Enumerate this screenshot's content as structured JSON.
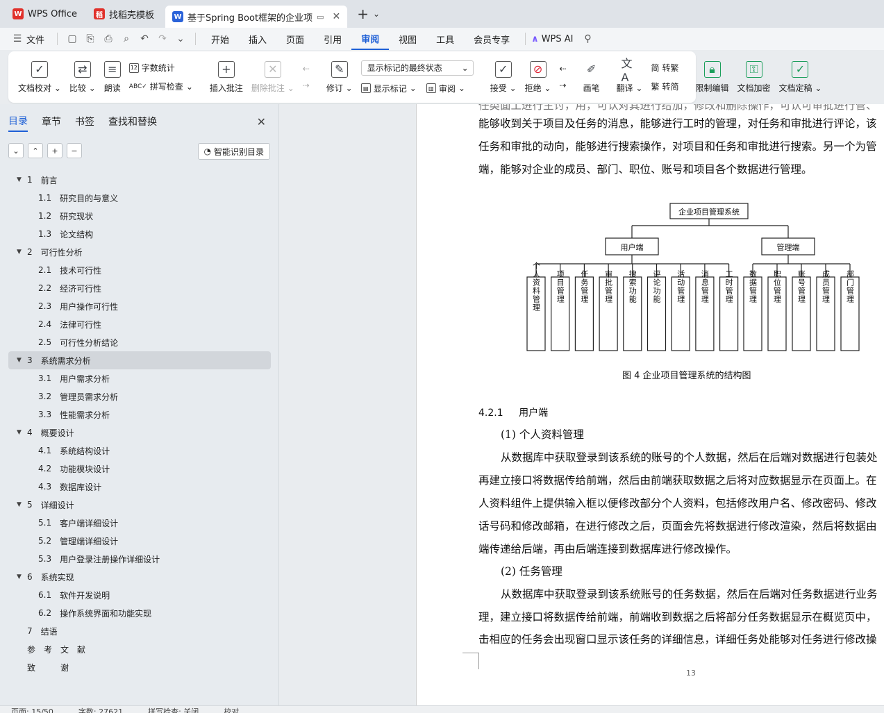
{
  "tabs": [
    {
      "label": "WPS Office",
      "icon": "wps-logo-icon",
      "color": "#e0312b"
    },
    {
      "label": "找稻壳模板",
      "icon": "docer-logo-icon",
      "color": "#e0312b"
    },
    {
      "label": "基于Spring Boot框架的企业项",
      "icon": "word-doc-icon",
      "color": "#2b63d9",
      "active": true
    }
  ],
  "menu": {
    "file": "文件",
    "items": [
      "开始",
      "插入",
      "页面",
      "引用",
      "审阅",
      "视图",
      "工具",
      "会员专享"
    ],
    "active": "审阅",
    "ai": "WPS AI"
  },
  "ribbon": {
    "doc_check": "文档校对",
    "compare": "比较",
    "read_aloud": "朗读",
    "word_count": "字数统计",
    "spell_check": "拼写检查",
    "insert_comment": "插入批注",
    "delete_comment": "删除批注",
    "revise": "修订",
    "markup_state": "显示标记的最终状态",
    "show_markup": "显示标记",
    "review": "审阅",
    "accept": "接受",
    "reject": "拒绝",
    "pen": "画笔",
    "translate": "翻译",
    "to_traditional": "转繁",
    "to_simplified": "转简",
    "restrict_edit": "限制编辑",
    "doc_encrypt": "文档加密",
    "doc_finalize": "文档定稿"
  },
  "sidebar": {
    "tabs": [
      "目录",
      "章节",
      "书签",
      "查找和替换"
    ],
    "active_tab": "目录",
    "smart_toc": "智能识别目录",
    "toc": [
      {
        "level": 1,
        "num": "1",
        "title": "前言",
        "expanded": true
      },
      {
        "level": 2,
        "num": "1.1",
        "title": "研究目的与意义"
      },
      {
        "level": 2,
        "num": "1.2",
        "title": "研究现状"
      },
      {
        "level": 2,
        "num": "1.3",
        "title": "论文结构"
      },
      {
        "level": 1,
        "num": "2",
        "title": "可行性分析",
        "expanded": true
      },
      {
        "level": 2,
        "num": "2.1",
        "title": "技术可行性"
      },
      {
        "level": 2,
        "num": "2.2",
        "title": "经济可行性"
      },
      {
        "level": 2,
        "num": "2.3",
        "title": "用户操作可行性"
      },
      {
        "level": 2,
        "num": "2.4",
        "title": "法律可行性"
      },
      {
        "level": 2,
        "num": "2.5",
        "title": "可行性分析结论"
      },
      {
        "level": 1,
        "num": "3",
        "title": "系统需求分析",
        "expanded": true,
        "selected": true
      },
      {
        "level": 2,
        "num": "3.1",
        "title": "用户需求分析"
      },
      {
        "level": 2,
        "num": "3.2",
        "title": "管理员需求分析"
      },
      {
        "level": 2,
        "num": "3.3",
        "title": "性能需求分析"
      },
      {
        "level": 1,
        "num": "4",
        "title": "概要设计",
        "expanded": true
      },
      {
        "level": 2,
        "num": "4.1",
        "title": "系统结构设计"
      },
      {
        "level": 2,
        "num": "4.2",
        "title": "功能模块设计"
      },
      {
        "level": 2,
        "num": "4.3",
        "title": "数据库设计"
      },
      {
        "level": 1,
        "num": "5",
        "title": "详细设计",
        "expanded": true
      },
      {
        "level": 2,
        "num": "5.1",
        "title": "客户端详细设计"
      },
      {
        "level": 2,
        "num": "5.2",
        "title": "管理端详细设计"
      },
      {
        "level": 2,
        "num": "5.3",
        "title": "用户登录注册操作详细设计"
      },
      {
        "level": 1,
        "num": "6",
        "title": "系统实现",
        "expanded": true
      },
      {
        "level": 2,
        "num": "6.1",
        "title": "软件开发说明"
      },
      {
        "level": 2,
        "num": "6.2",
        "title": "操作系统界面和功能实现"
      },
      {
        "level": 1,
        "num": "7",
        "title": "结语",
        "noarrow": true
      },
      {
        "level": 1,
        "num": "",
        "title": "参　考　文　献",
        "noarrow": true
      },
      {
        "level": 1,
        "num": "",
        "title": "致　　　谢",
        "noarrow": true
      }
    ]
  },
  "document": {
    "top_lines": [
      "任类面工进行主讨，用，可认对其进行给加，修改和删除操作，可认可审批进行管、",
      "能够收到关于项目及任务的消息，能够进行工时的管理，对任务和审批进行评论，该",
      "任务和审批的动向，能够进行搜索操作，对项目和任务和审批进行搜索。另一个为管",
      "端，能够对企业的成员、部门、职位、账号和项目各个数据进行管理。"
    ],
    "diagram": {
      "root": "企业项目管理系统",
      "branches": [
        "用户端",
        "管理端"
      ],
      "user_leaves": [
        "个人资料管理",
        "项目管理",
        "任务管理",
        "审批管理",
        "搜索功能",
        "评论功能",
        "活动管理",
        "消息管理",
        "工时管理"
      ],
      "admin_leaves": [
        "数据管理",
        "职位管理",
        "账号管理",
        "成员管理",
        "部门管理"
      ]
    },
    "caption": "图 4  企业项目管理系统的结构图",
    "section_num": "4.2.1",
    "section_title": "用户端",
    "body_lines": [
      "(1)  个人资料管理",
      "从数据库中获取登录到该系统的账号的个人数据，然后在后端对数据进行包装处",
      "再建立接口将数据传给前端，然后由前端获取数据之后将对应数据显示在页面上。在",
      "人资料组件上提供输入框以便修改部分个人资料，包括修改用户名、修改密码、修改",
      "话号码和修改邮箱，在进行修改之后，页面会先将数据进行修改渲染，然后将数据由",
      "端传递给后端，再由后端连接到数据库进行修改操作。",
      "(2)  任务管理",
      "从数据库中获取登录到该系统账号的任务数据，然后在后端对任务数据进行业务",
      "理，建立接口将数据传给前端，前端收到数据之后将部分任务数据显示在概览页中，",
      "击相应的任务会出现窗口显示该任务的详细信息，详细任务处能够对任务进行修改操"
    ],
    "page_number": "13"
  },
  "status": {
    "page": "页面: 15/50",
    "words": "字数: 27621",
    "spell": "拼写检查: 关闭",
    "proof": "校对"
  }
}
